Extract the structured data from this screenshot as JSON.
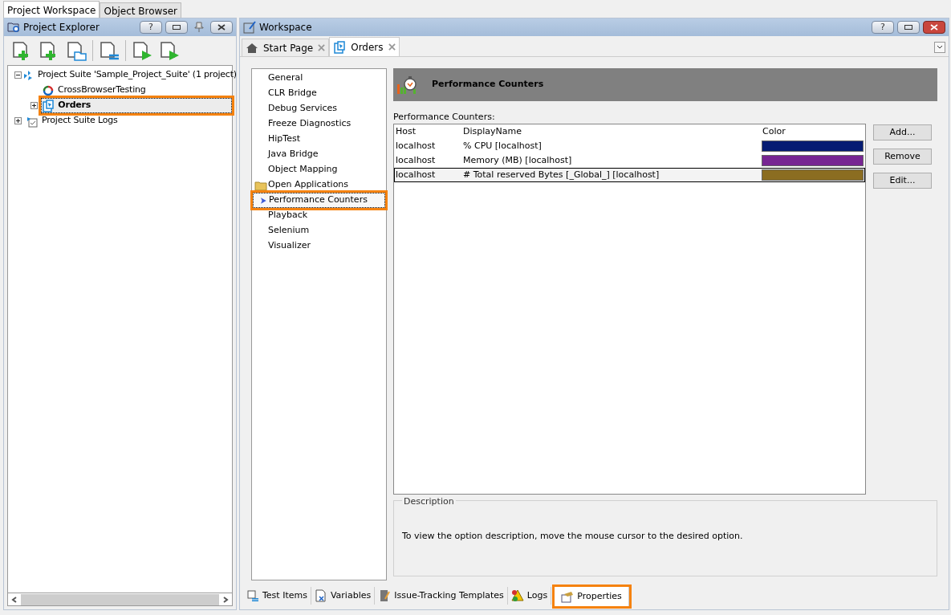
{
  "top_tabs": [
    {
      "label": "Project Workspace",
      "selected": true
    },
    {
      "label": "Object Browser",
      "selected": false
    }
  ],
  "explorer": {
    "title": "Project Explorer",
    "help": "?",
    "tree": [
      {
        "label": "Project Suite 'Sample_Project_Suite' (1 project)",
        "kind": "suite",
        "expanded": true,
        "selected": false,
        "highlighted": false,
        "children": [
          {
            "label": "CrossBrowserTesting",
            "kind": "crossbrowser",
            "selected": false,
            "highlighted": false
          },
          {
            "label": "Orders",
            "kind": "project",
            "expanded": false,
            "selected": true,
            "highlighted": true
          }
        ]
      },
      {
        "label": "Project Suite Logs",
        "kind": "logs",
        "expanded": false,
        "selected": false,
        "highlighted": false
      }
    ]
  },
  "workspace": {
    "title": "Workspace",
    "help": "?",
    "doc_tabs": [
      {
        "label": "Start Page",
        "kind": "home",
        "selected": false
      },
      {
        "label": "Orders",
        "kind": "project",
        "selected": true
      }
    ],
    "options": [
      {
        "label": "General",
        "kind": "plain",
        "selected": false,
        "highlighted": false
      },
      {
        "label": "CLR Bridge",
        "kind": "plain",
        "selected": false,
        "highlighted": false
      },
      {
        "label": "Debug Services",
        "kind": "plain",
        "selected": false,
        "highlighted": false
      },
      {
        "label": "Freeze Diagnostics",
        "kind": "plain",
        "selected": false,
        "highlighted": false
      },
      {
        "label": "HipTest",
        "kind": "plain",
        "selected": false,
        "highlighted": false
      },
      {
        "label": "Java Bridge",
        "kind": "plain",
        "selected": false,
        "highlighted": false
      },
      {
        "label": "Object Mapping",
        "kind": "plain",
        "selected": false,
        "highlighted": false
      },
      {
        "label": "Open Applications",
        "kind": "folder",
        "selected": false,
        "highlighted": false
      },
      {
        "label": "Performance Counters",
        "kind": "plain",
        "selected": true,
        "highlighted": true
      },
      {
        "label": "Playback",
        "kind": "plain",
        "selected": false,
        "highlighted": false
      },
      {
        "label": "Selenium",
        "kind": "plain",
        "selected": false,
        "highlighted": false
      },
      {
        "label": "Visualizer",
        "kind": "plain",
        "selected": false,
        "highlighted": false
      }
    ],
    "banner": "Performance Counters",
    "counters_label": "Performance Counters:",
    "table": {
      "columns": [
        "Host",
        "DisplayName",
        "Color"
      ],
      "rows": [
        {
          "host": "localhost",
          "display_name": "% CPU [localhost]",
          "color": "#061c73",
          "selected": false
        },
        {
          "host": "localhost",
          "display_name": "Memory (MB) [localhost]",
          "color": "#772592",
          "selected": false
        },
        {
          "host": "localhost",
          "display_name": "# Total reserved Bytes [_Global_] [localhost]",
          "color": "#8b6d21",
          "selected": true
        }
      ]
    },
    "buttons": [
      "Add...",
      "Remove",
      "Edit..."
    ],
    "description": {
      "title": "Description",
      "text": "To view the option description, move the mouse cursor to the desired option."
    },
    "bottom_tabs": [
      {
        "label": "Test Items",
        "kind": "items",
        "selected": false,
        "highlighted": false
      },
      {
        "label": "Variables",
        "kind": "variables",
        "selected": false,
        "highlighted": false
      },
      {
        "label": "Issue-Tracking Templates",
        "kind": "templates",
        "selected": false,
        "highlighted": false
      },
      {
        "label": "Logs",
        "kind": "logs",
        "selected": false,
        "highlighted": false
      },
      {
        "label": "Properties",
        "kind": "properties",
        "selected": true,
        "highlighted": true
      }
    ]
  }
}
